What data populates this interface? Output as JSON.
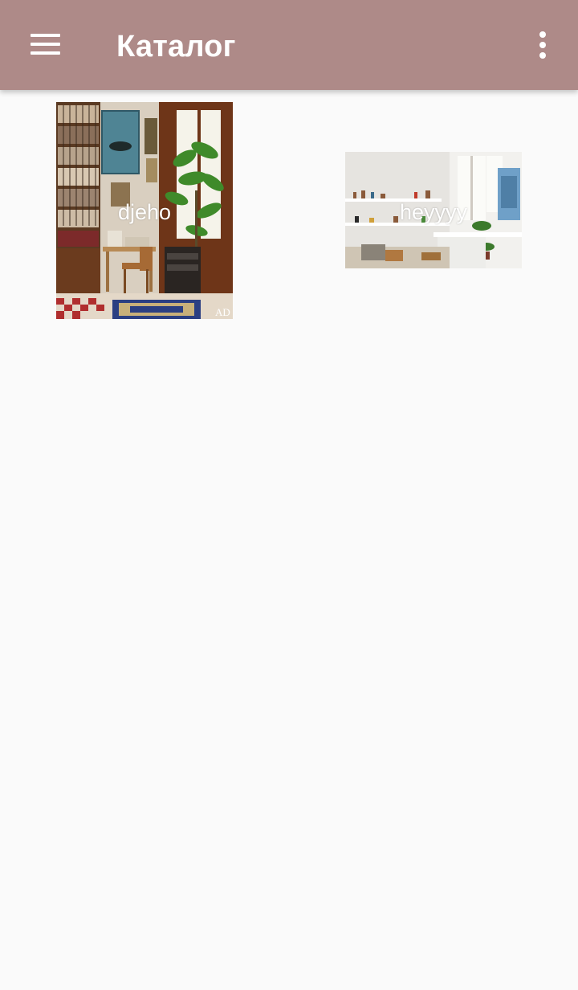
{
  "app_bar": {
    "title": "Каталог",
    "menu_icon": "hamburger-menu-icon",
    "overflow_icon": "more-vert-icon",
    "color": "#ae8a88"
  },
  "catalog": {
    "items": [
      {
        "label": "djeho",
        "image": "library-room-photo"
      },
      {
        "label": "heyyyy",
        "image": "bright-kitchen-room-photo"
      }
    ]
  }
}
